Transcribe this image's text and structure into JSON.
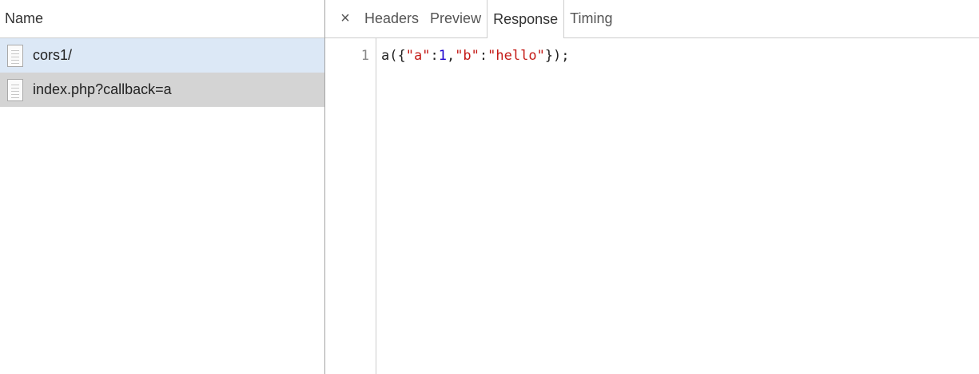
{
  "left_pane": {
    "header": "Name",
    "requests": [
      {
        "label": "cors1/",
        "state": "selected"
      },
      {
        "label": "index.php?callback=a",
        "state": "hover"
      }
    ]
  },
  "tabs": {
    "close_glyph": "×",
    "items": [
      "Headers",
      "Preview",
      "Response",
      "Timing"
    ],
    "active": "Response"
  },
  "response": {
    "line_number": "1",
    "tokens": [
      {
        "text": "a({",
        "kind": "plain"
      },
      {
        "text": "\"a\"",
        "kind": "string"
      },
      {
        "text": ":",
        "kind": "plain"
      },
      {
        "text": "1",
        "kind": "number"
      },
      {
        "text": ",",
        "kind": "plain"
      },
      {
        "text": "\"b\"",
        "kind": "string"
      },
      {
        "text": ":",
        "kind": "plain"
      },
      {
        "text": "\"hello\"",
        "kind": "string"
      },
      {
        "text": "});",
        "kind": "plain"
      }
    ]
  },
  "colors": {
    "selected_row": "#dce8f6",
    "hover_row": "#d4d4d4",
    "string": "#c41a16",
    "number": "#1c00cf"
  }
}
